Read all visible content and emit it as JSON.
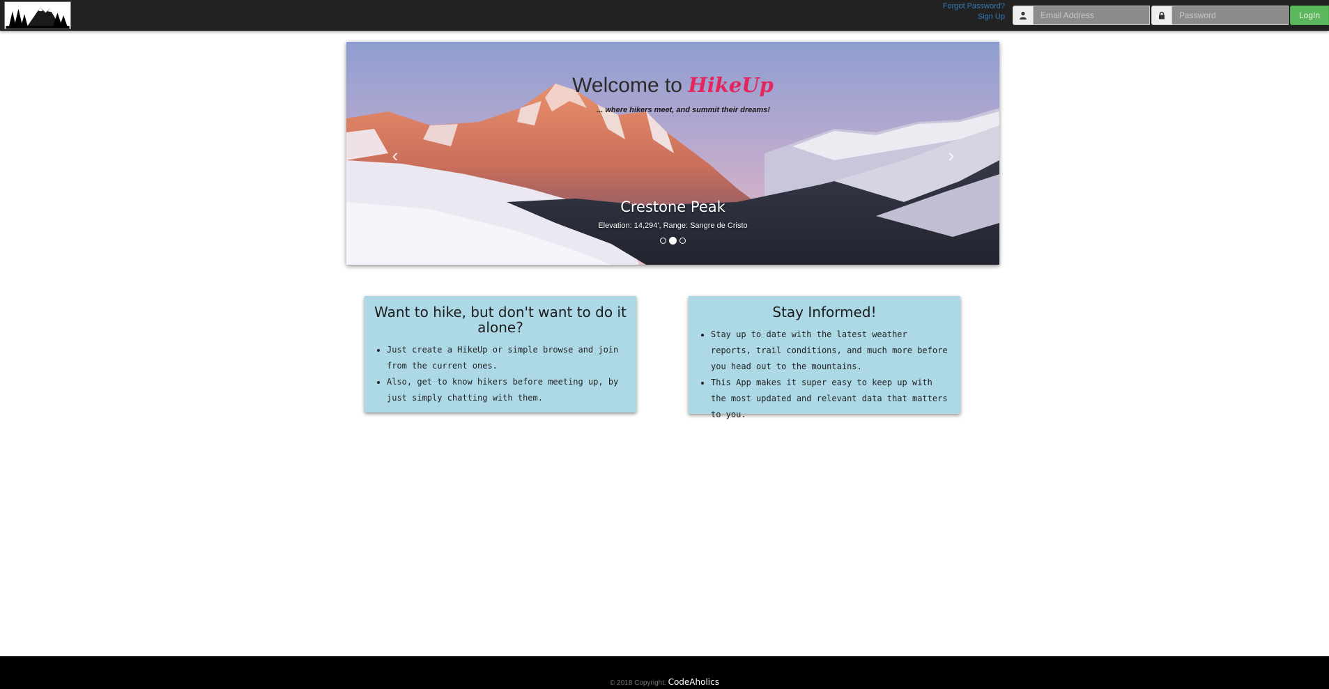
{
  "navbar": {
    "forgot_password": "Forgot Password?",
    "sign_up": "Sign Up",
    "email_placeholder": "Email Address",
    "password_placeholder": "Password",
    "login_label": "LogIn",
    "icons": [
      "user-icon",
      "lock-icon"
    ]
  },
  "hero": {
    "welcome_text": "Welcome to",
    "brand": "HikeUp",
    "tagline": "... where hikers meet, and summit their dreams!",
    "prev_arrow": "‹",
    "next_arrow": "›",
    "slide_title": "Crestone Peak",
    "slide_subtitle": "Elevation: 14,294', Range: Sangre de Cristo",
    "slide_count": 3,
    "active_slide": 2
  },
  "cards": [
    {
      "title": "Want to hike, but don't want to do it alone?",
      "items": [
        "Just create a HikeUp or simple browse and join from the current ones.",
        "Also, get to know hikers before meeting up, by just simply chatting with them."
      ]
    },
    {
      "title": "Stay Informed!",
      "items": [
        "Stay up to date with the latest weather reports, trail conditions, and much more before you head out to the mountains.",
        "This App makes it super easy to keep up with the most updated and relevant data that matters to you."
      ]
    }
  ],
  "footer": {
    "copyright": "© 2018 Copyright:",
    "author": "CodeAholics"
  },
  "colors": {
    "navbar_bg": "#222222",
    "brand_pink": "#e5265e",
    "card_bg": "#add8e6",
    "login_green": "#5cb85c",
    "footer_bg": "#000000"
  }
}
